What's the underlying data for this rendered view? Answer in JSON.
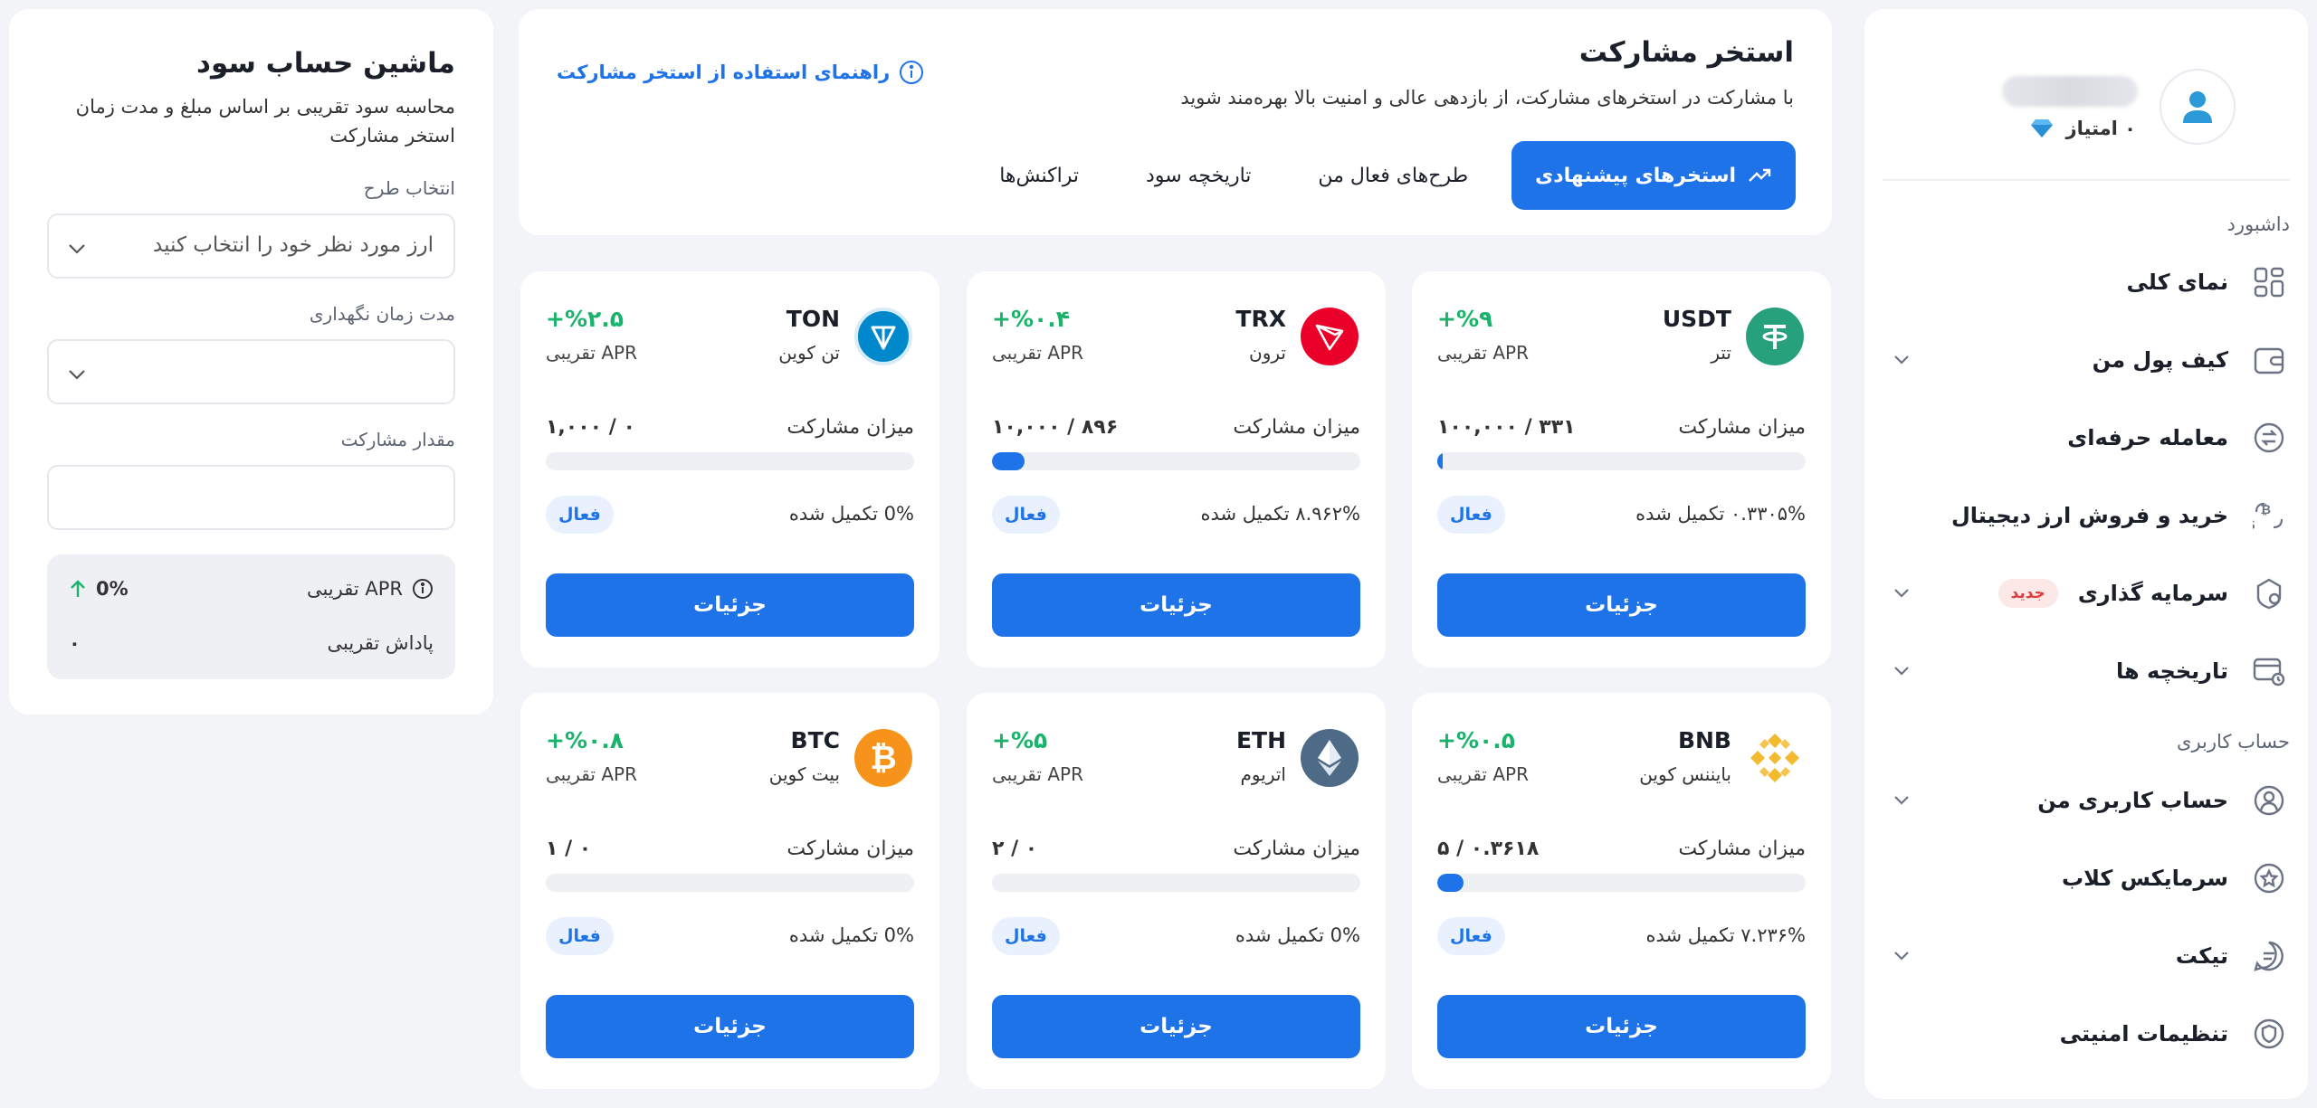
{
  "sidebar": {
    "points_label": "۰ امتیاز",
    "sections": {
      "dashboard": "داشبورد",
      "account": "حساب کاربری"
    },
    "items": [
      {
        "label": "نمای کلی",
        "icon": "grid-icon"
      },
      {
        "label": "کیف پول من",
        "icon": "wallet-icon"
      },
      {
        "label": "معامله حرفه‌ای",
        "icon": "exchange-icon"
      },
      {
        "label": "خرید و فروش ارز دیجیتال",
        "icon": "crypto-swap-icon"
      },
      {
        "label": "سرمایه گذاری",
        "icon": "investment-icon",
        "badge": "جدید"
      },
      {
        "label": "تاریخچه ها",
        "icon": "history-icon"
      },
      {
        "label": "حساب کاربری من",
        "icon": "user-icon"
      },
      {
        "label": "سرمایکس کلاب",
        "icon": "star-club-icon"
      },
      {
        "label": "تیکت",
        "icon": "ticket-icon"
      },
      {
        "label": "تنظیمات امنیتی",
        "icon": "shield-icon"
      }
    ]
  },
  "header": {
    "title": "استخر مشارکت",
    "subtitle": "با مشارکت در استخرهای مشارکت، از بازدهی عالی و امنیت بالا بهره‌مند شوید",
    "guide_link": "راهنمای استفاده از استخر مشارکت",
    "tabs": [
      "استخرهای پیشنهادی",
      "طرح‌های فعال من",
      "تاریخچه سود",
      "تراکنش‌ها"
    ]
  },
  "colors": {
    "accent": "#1e73e8",
    "green": "#19b36b",
    "usdt": "#26a17b",
    "trx": "#eb0029",
    "ton": "#0088cc",
    "bnb": "#f3ba2f",
    "eth": "#627eea",
    "btc": "#f7931a"
  },
  "cards": [
    {
      "symbol": "USDT",
      "name": "تتر",
      "apr": "+%۹",
      "apr_label": "APR تقریبی",
      "participation_label": "میزان مشارکت",
      "participation": "۳۳۱ / ۱۰۰,۰۰۰",
      "progress": 0.0033,
      "done": "۰.۳۳۰۵% تکمیل شده",
      "status": "فعال",
      "button": "جزئیات"
    },
    {
      "symbol": "TRX",
      "name": "ترون",
      "apr": "+%۰.۴",
      "apr_label": "APR تقریبی",
      "participation_label": "میزان مشارکت",
      "participation": "۸۹۶ / ۱۰,۰۰۰",
      "progress": 0.0896,
      "done": "۸.۹۶۲% تکمیل شده",
      "status": "فعال",
      "button": "جزئیات"
    },
    {
      "symbol": "TON",
      "name": "تن کوین",
      "apr": "+%۲.۵",
      "apr_label": "APR تقریبی",
      "participation_label": "میزان مشارکت",
      "participation": "۰ / ۱,۰۰۰",
      "progress": 0,
      "done": "0% تکمیل شده",
      "status": "فعال",
      "button": "جزئیات"
    },
    {
      "symbol": "BNB",
      "name": "بایننس کوین",
      "apr": "+%۰.۵",
      "apr_label": "APR تقریبی",
      "participation_label": "میزان مشارکت",
      "participation": "۰.۳۶۱۸ / ۵",
      "progress": 0.0724,
      "done": "۷.۲۳۶% تکمیل شده",
      "status": "فعال",
      "button": "جزئیات"
    },
    {
      "symbol": "ETH",
      "name": "اتریوم",
      "apr": "+%۵",
      "apr_label": "APR تقریبی",
      "participation_label": "میزان مشارکت",
      "participation": "۰ / ۲",
      "progress": 0,
      "done": "0% تکمیل شده",
      "status": "فعال",
      "button": "جزئیات"
    },
    {
      "symbol": "BTC",
      "name": "بیت کوین",
      "apr": "+%۰.۸",
      "apr_label": "APR تقریبی",
      "participation_label": "میزان مشارکت",
      "participation": "۰ / ۱",
      "progress": 0,
      "done": "0% تکمیل شده",
      "status": "فعال",
      "button": "جزئیات"
    }
  ],
  "calculator": {
    "title": "ماشین حساب سود",
    "description": "محاسبه سود تقریبی بر اساس مبلغ و مدت زمان استخر مشارکت",
    "plan_label": "انتخاب طرح",
    "plan_placeholder": "ارز مورد نظر خود را انتخاب کنید",
    "duration_label": "مدت زمان نگهداری",
    "amount_label": "مقدار مشارکت",
    "apr_label": "APR تقریبی",
    "apr_value": "0%",
    "reward_label": "پاداش تقریبی",
    "reward_value": "۰"
  }
}
